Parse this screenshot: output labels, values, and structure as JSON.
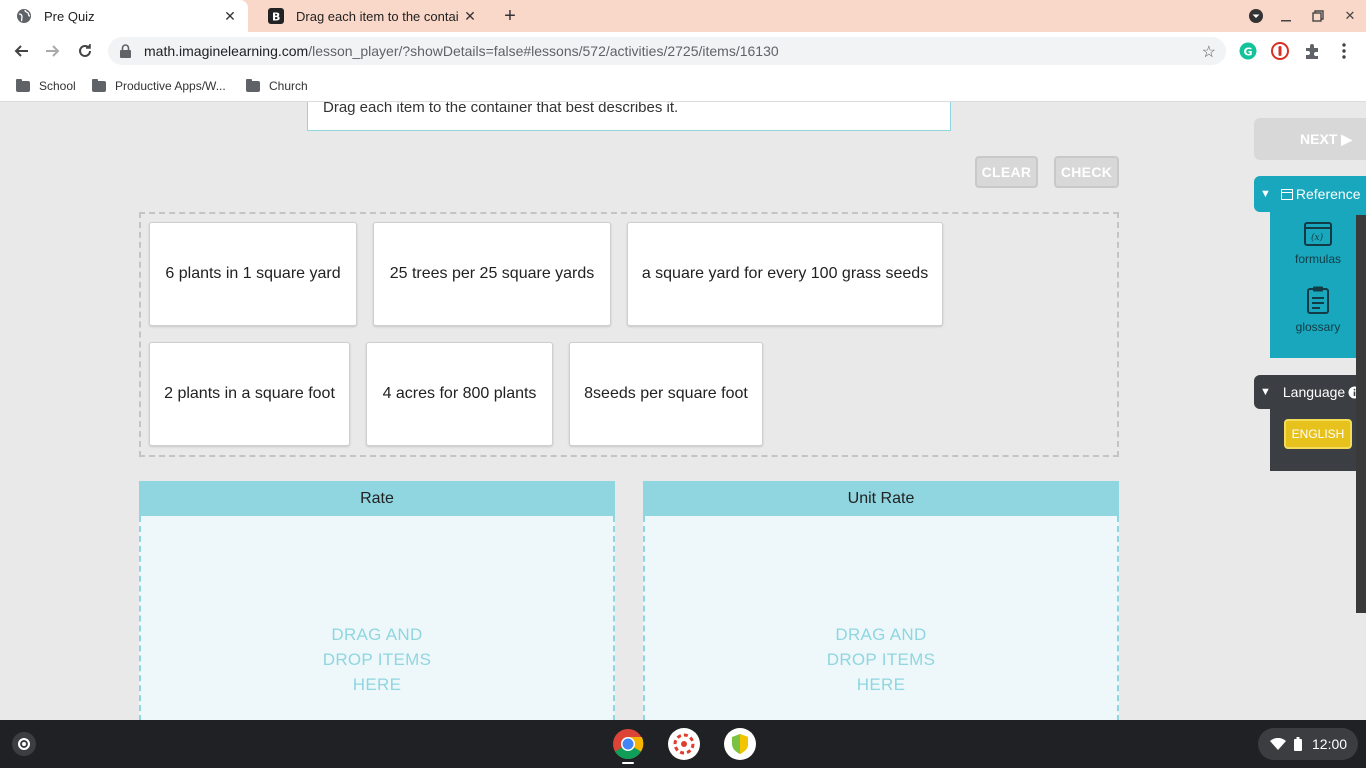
{
  "browser": {
    "tabs": [
      {
        "title": "Pre Quiz",
        "active": true,
        "favicon": "globe-icon"
      },
      {
        "title": "Drag each item to the container",
        "active": false,
        "favicon": "b-icon"
      }
    ],
    "url_host": "math.imaginelearning.com",
    "url_path": "/lesson_player/?showDetails=false#lessons/572/activities/2725/items/16130",
    "bookmarks": [
      "School",
      "Productive Apps/W...",
      "Church"
    ]
  },
  "lesson": {
    "prompt": "Drag each item to the container that best describes it.",
    "clear_label": "CLEAR",
    "check_label": "CHECK",
    "next_label": "NEXT ▶",
    "cards": [
      "6 plants in 1 square yard",
      "25 trees per 25 square yards",
      "a square yard for every 100 grass seeds",
      "2 plants in a square foot",
      "4 acres for 800 plants",
      "8seeds per square foot"
    ],
    "bins": [
      {
        "title": "Rate",
        "hint": "DRAG AND DROP ITEMS HERE"
      },
      {
        "title": "Unit Rate",
        "hint": "DRAG AND DROP ITEMS HERE"
      }
    ]
  },
  "sidebar": {
    "reference_label": "Reference",
    "formulas_label": "formulas",
    "glossary_label": "glossary",
    "language_label": "Language",
    "english_label": "ENGLISH"
  },
  "shelf": {
    "time": "12:00",
    "apps": [
      "chrome-icon",
      "canvas-icon",
      "vpn-shield-icon"
    ]
  },
  "colors": {
    "accent": "#18a7bd",
    "bin_header": "#8fd6e0",
    "tab_strip": "#f9d8c9",
    "language_button": "#e8c21c"
  }
}
